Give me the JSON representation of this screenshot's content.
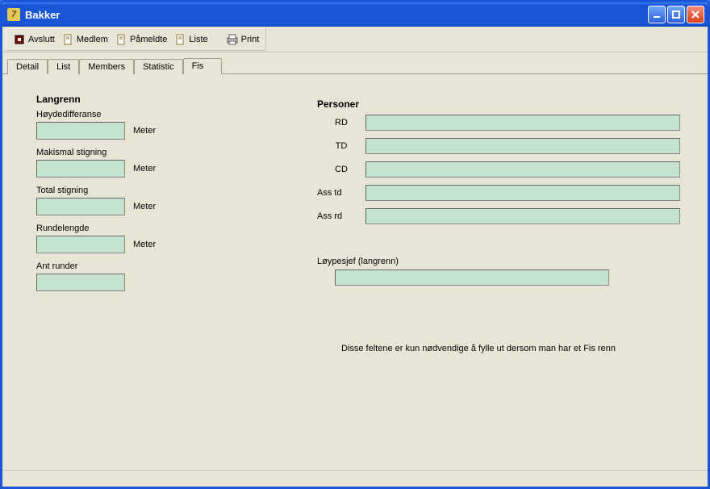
{
  "window": {
    "title": "Bakker"
  },
  "toolbar": {
    "avslutt": "Avslutt",
    "medlem": "Medlem",
    "pameldte": "Påmeldte",
    "liste": "Liste",
    "print": "Print"
  },
  "tabs": {
    "detail": "Detail",
    "list": "List",
    "members": "Members",
    "statistic": "Statistic",
    "fis": "Fis"
  },
  "langrenn": {
    "title": "Langrenn",
    "hoydediff_label": "Høydedifferanse",
    "maksimal_label": "Makismal stigning",
    "total_label": "Total stigning",
    "rundelengde_label": "Rundelengde",
    "antrunder_label": "Ant runder",
    "unit_meter": "Meter",
    "hoydediff_value": "",
    "maksimal_value": "",
    "total_value": "",
    "rundelengde_value": "",
    "antrunder_value": ""
  },
  "personer": {
    "title": "Personer",
    "rd_label": "RD",
    "td_label": "TD",
    "cd_label": "CD",
    "asstd_label": "Ass td",
    "assrd_label": "Ass rd",
    "rd_value": "",
    "td_value": "",
    "cd_value": "",
    "asstd_value": "",
    "assrd_value": "",
    "loypesjef_label": "Løypesjef (langrenn)",
    "loypesjef_value": ""
  },
  "note": "Disse feltene er kun nødvendige å fylle ut dersom man har et Fis renn"
}
